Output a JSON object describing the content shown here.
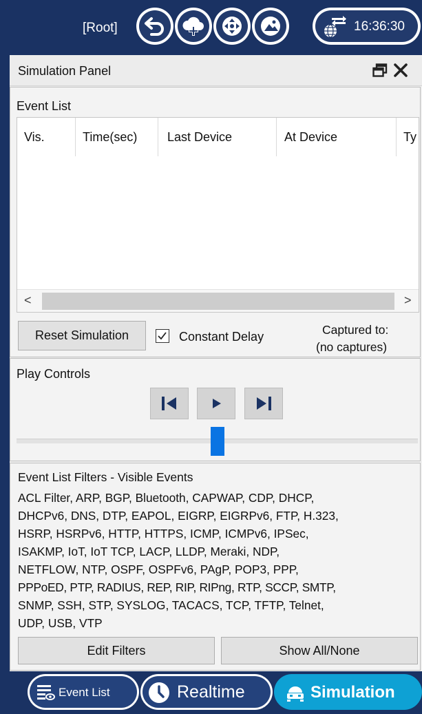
{
  "topbar": {
    "root_label": "[Root]",
    "buttons": [
      {
        "icon": "back-arrow-icon"
      },
      {
        "icon": "cloud-add-icon"
      },
      {
        "icon": "move-arrows-icon"
      },
      {
        "icon": "landscape-image-icon"
      }
    ],
    "clock": {
      "icon": "network-globe-icon",
      "time": "16:36:30"
    }
  },
  "panel": {
    "title": "Simulation Panel",
    "event_list": {
      "label": "Event List",
      "columns": [
        "Vis.",
        "Time(sec)",
        "Last Device",
        "At Device",
        "Ty"
      ],
      "rows": [],
      "scroll_left": "<",
      "scroll_right": ">"
    },
    "reset_button": "Reset Simulation",
    "constant_delay": {
      "label": "Constant Delay",
      "checked": true
    },
    "captured_to": "Captured to:",
    "captures": "(no captures)",
    "play_controls": {
      "label": "Play Controls",
      "buttons": [
        "step-back-icon",
        "play-icon",
        "step-forward-icon"
      ]
    },
    "filters": {
      "label": "Event List Filters - Visible Events",
      "lines": [
        "ACL Filter, ARP, BGP, Bluetooth, CAPWAP, CDP, DHCP,",
        "DHCPv6, DNS, DTP, EAPOL, EIGRP, EIGRPv6, FTP, H.323,",
        "HSRP, HSRPv6, HTTP, HTTPS, ICMP, ICMPv6, IPSec,",
        "ISAKMP, IoT, IoT TCP, LACP, LLDP, Meraki, NDP,",
        "NETFLOW, NTP, OSPF, OSPFv6, PAgP, POP3, PPP,",
        "PPPoED, PTP, RADIUS, REP, RIP, RIPng, RTP, SCCP, SMTP,",
        "SNMP, SSH, STP, SYSLOG, TACACS, TCP, TFTP, Telnet,",
        "UDP, USB, VTP"
      ],
      "edit_button": "Edit Filters",
      "show_button": "Show All/None"
    }
  },
  "bottom_tabs": [
    {
      "label": "Event List",
      "icon": "event-list-icon",
      "active": false
    },
    {
      "label": "Realtime",
      "icon": "clock-icon",
      "active": false
    },
    {
      "label": "Simulation",
      "icon": "simulation-icon",
      "active": true
    }
  ],
  "colors": {
    "top_bar": "#1a3263",
    "button_inner": "#223a6c",
    "slider_thumb": "#0a74e3",
    "active_tab": "#0ea1d4"
  }
}
